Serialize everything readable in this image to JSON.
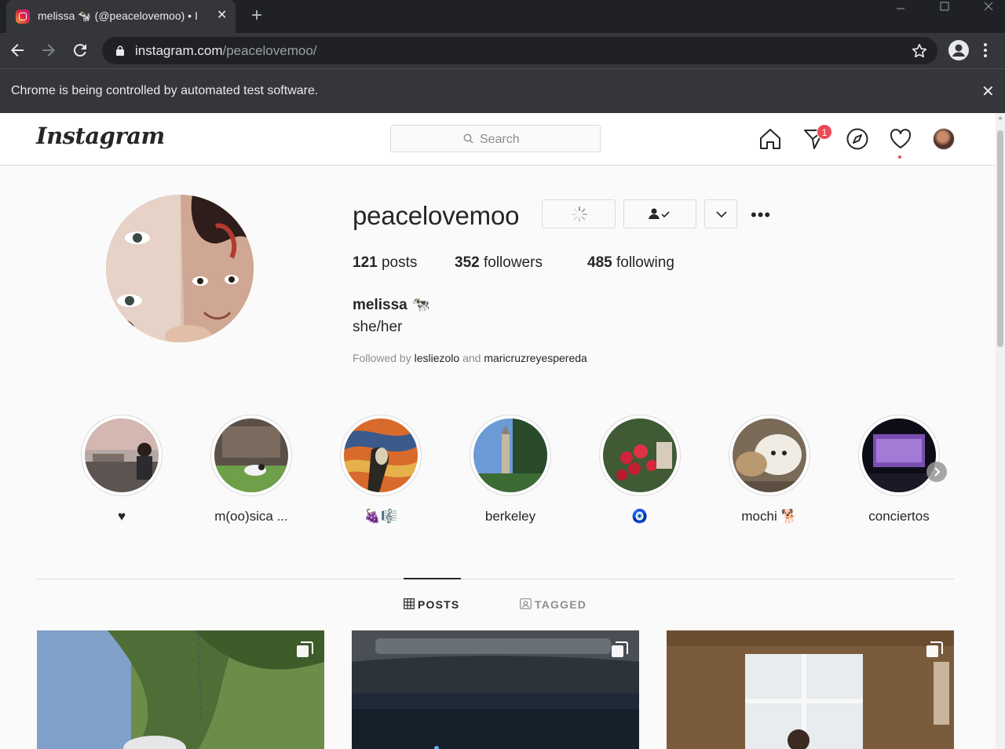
{
  "browser": {
    "tab_title": "melissa 🐄 (@peacelovemoo) • I",
    "tab_close": "✕",
    "new_tab": "+",
    "url_host": "instagram.com",
    "url_path": "/peacelovemoo/",
    "infobar_text": "Chrome is being controlled by automated test software.",
    "infobar_close": "✕"
  },
  "ig": {
    "logo": "Instagram",
    "search_placeholder": "Search",
    "notification_count": "1"
  },
  "profile": {
    "username": "peacelovemoo",
    "more": "•••",
    "stats": {
      "posts_count": "121",
      "posts_label": " posts",
      "followers_count": "352",
      "followers_label": " followers",
      "following_count": "485",
      "following_label": " following"
    },
    "full_name": "melissa 🐄",
    "bio": "she/her",
    "followed_by_prefix": "Followed by ",
    "followed_by_1": "lesliezolo",
    "followed_by_and": " and ",
    "followed_by_2": "maricruzreyespereda"
  },
  "highlights": [
    {
      "label": "♥"
    },
    {
      "label": "m(oo)sica ..."
    },
    {
      "label": "🍇🎼"
    },
    {
      "label": "berkeley"
    },
    {
      "label": "🧿"
    },
    {
      "label": "mochi 🐕"
    },
    {
      "label": "conciertos"
    }
  ],
  "tabs": {
    "posts": "POSTS",
    "tagged": "TAGGED"
  },
  "colors": {
    "accent_red": "#ed4956",
    "text": "#262626",
    "muted": "#8e8e8e",
    "border": "#dbdbdb"
  }
}
